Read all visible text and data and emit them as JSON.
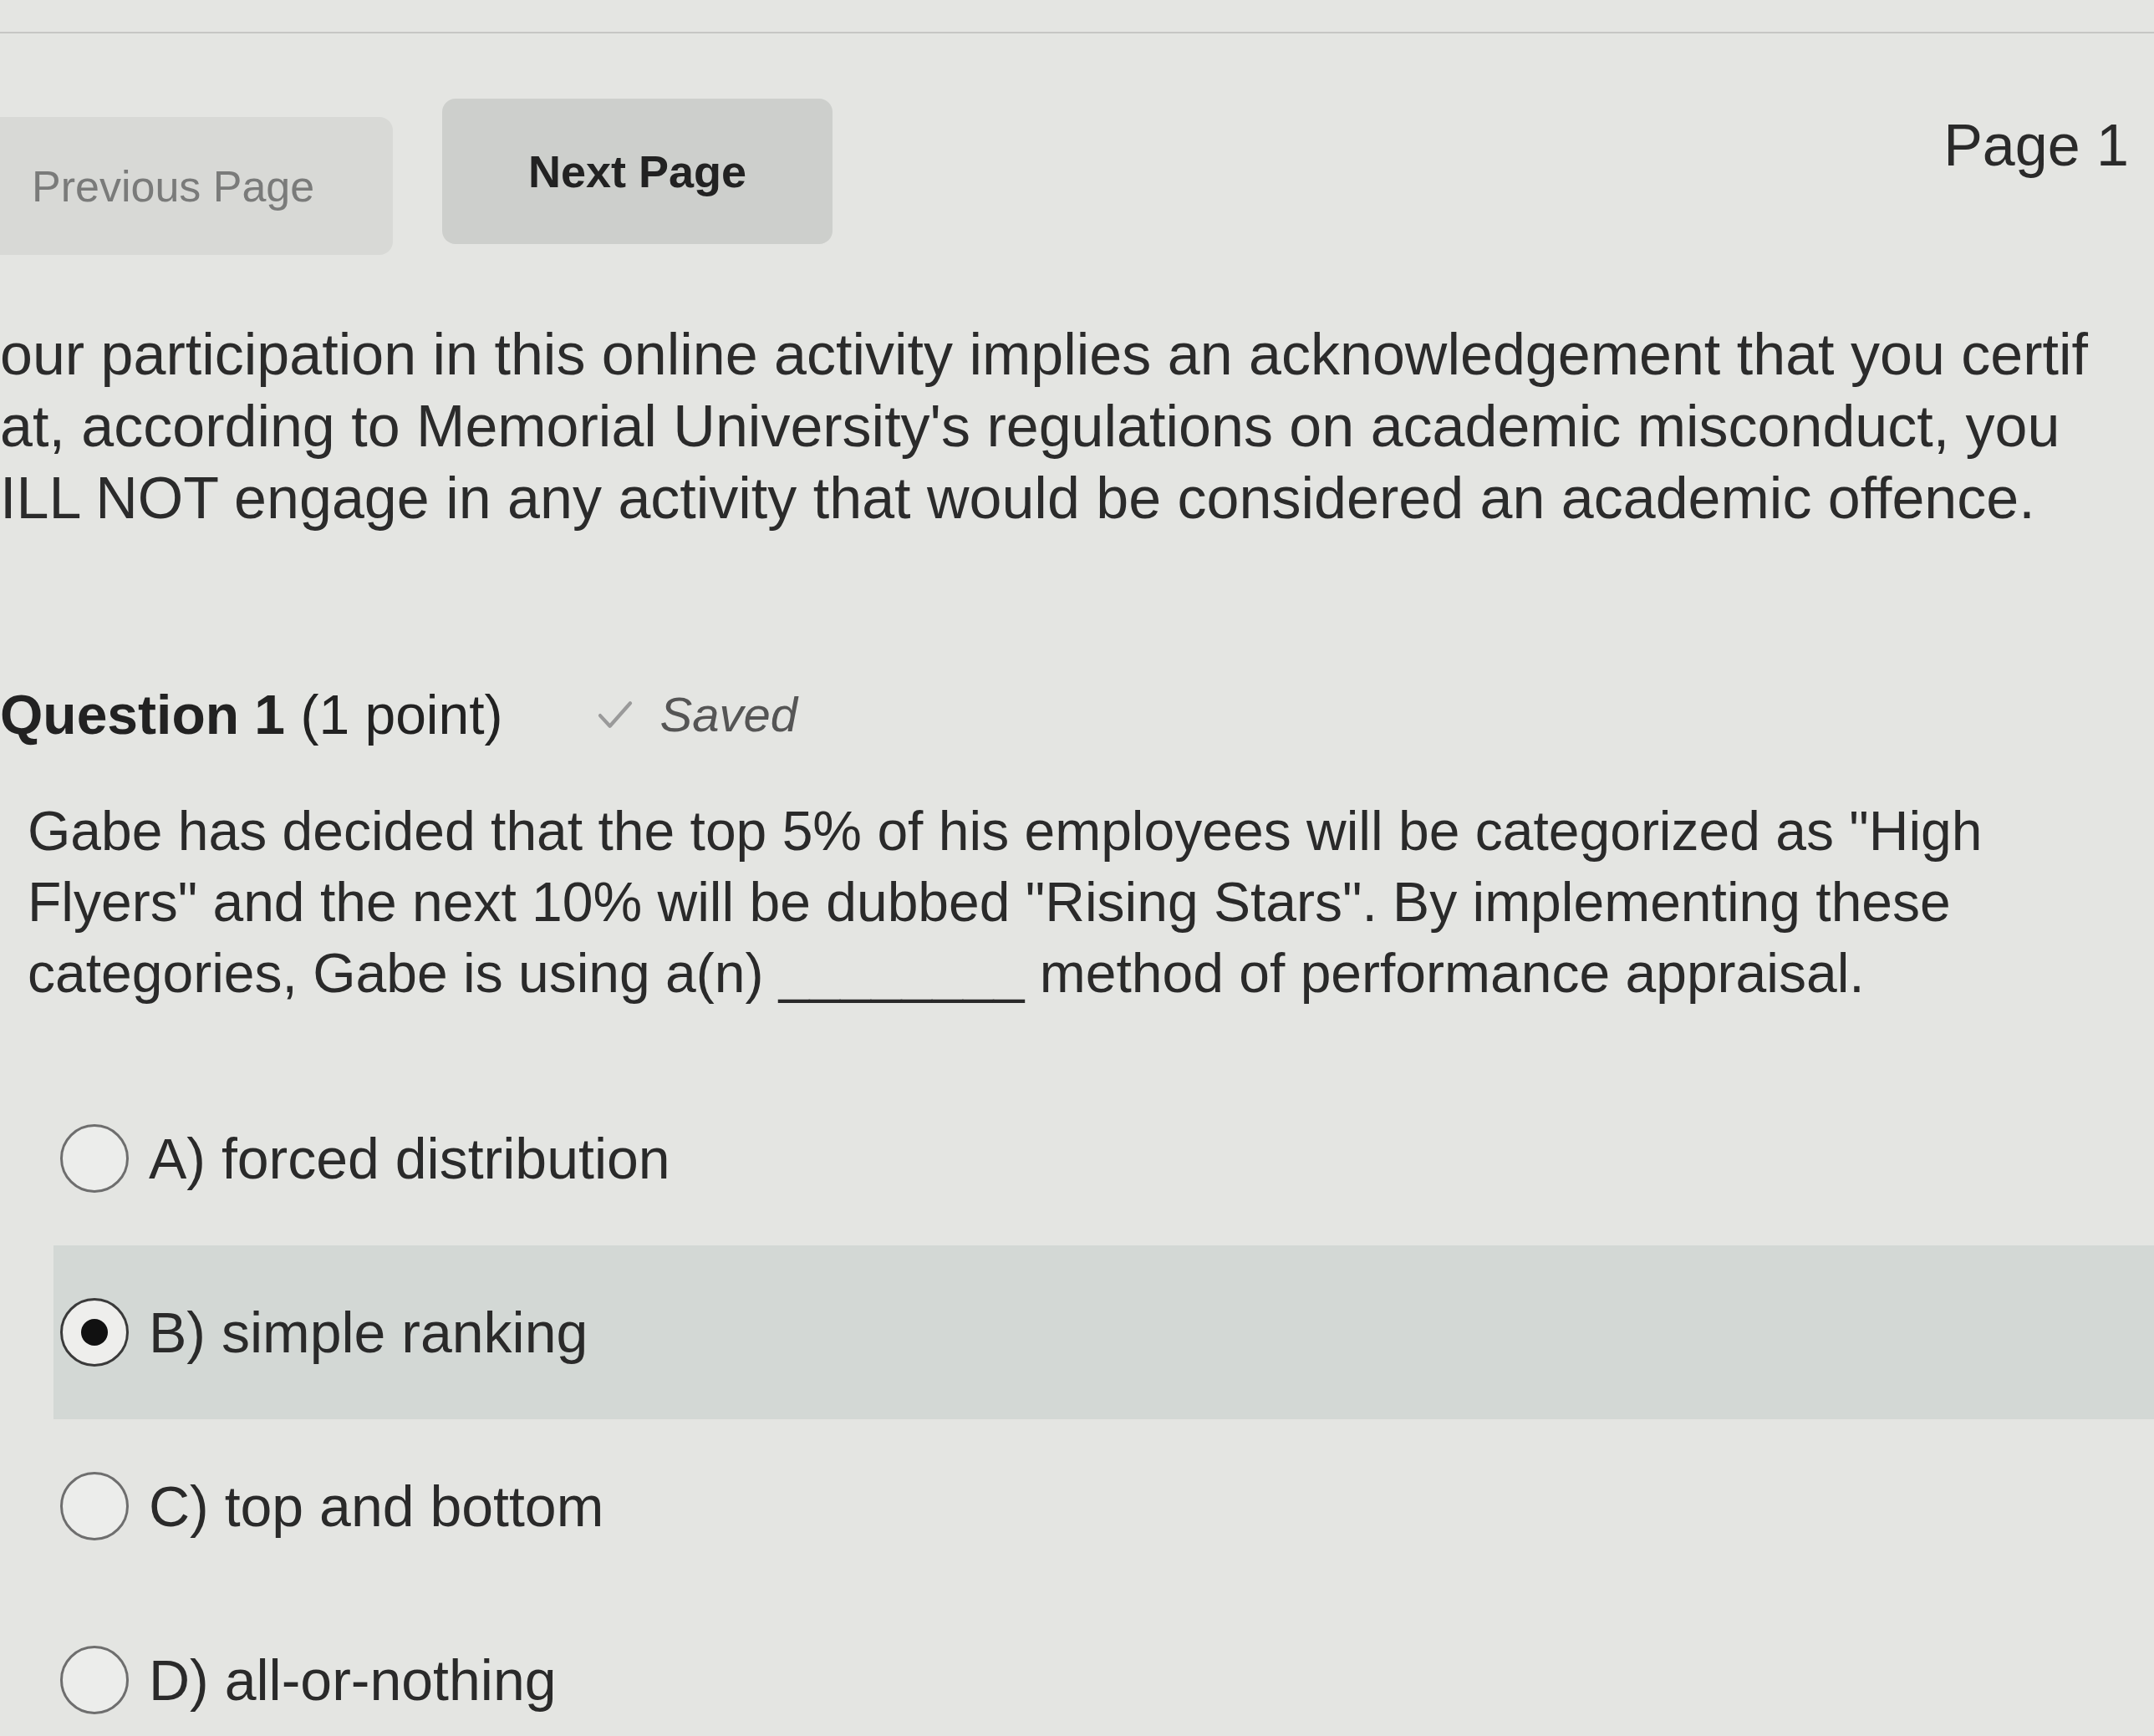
{
  "navigation": {
    "previous_button": {
      "label": "Previous Page",
      "disabled": true
    },
    "next_button": {
      "label": "Next Page",
      "disabled": false
    },
    "page_indicator": "Page 1"
  },
  "notice": {
    "lines": [
      "our participation in this online activity implies an acknowledgement that you certif",
      "at, according to Memorial University's regulations on academic misconduct, you",
      "ILL NOT engage in any activity that would be considered an academic offence."
    ]
  },
  "question": {
    "title": "**Question 1** (1 point)",
    "status": "Saved",
    "text": "Gabe has decided that the top 5% of his employees will be categorized as \"High Flyers\" and the next 10% will be dubbed \"Rising Stars\". By implementing these categories, Gabe is using a(n) ________ method of performance appraisal.",
    "options": [
      {
        "label": "A) forced distribution",
        "selected": false
      },
      {
        "label": "B) simple ranking",
        "selected": true
      },
      {
        "label": "C) top and bottom",
        "selected": false
      },
      {
        "label": "D) all-or-nothing",
        "selected": false
      }
    ]
  }
}
